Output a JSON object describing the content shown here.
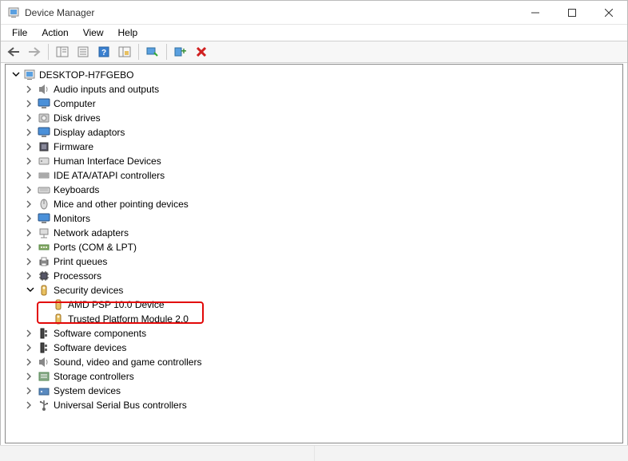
{
  "window": {
    "title": "Device Manager"
  },
  "menu": {
    "file": "File",
    "action": "Action",
    "view": "View",
    "help": "Help"
  },
  "tree": {
    "root": "DESKTOP-H7FGEBO",
    "categories": [
      {
        "label": "Audio inputs and outputs",
        "icon": "speaker",
        "expanded": false
      },
      {
        "label": "Computer",
        "icon": "monitor",
        "expanded": false
      },
      {
        "label": "Disk drives",
        "icon": "disk",
        "expanded": false
      },
      {
        "label": "Display adaptors",
        "icon": "monitor",
        "expanded": false
      },
      {
        "label": "Firmware",
        "icon": "chip",
        "expanded": false
      },
      {
        "label": "Human Interface Devices",
        "icon": "hid",
        "expanded": false
      },
      {
        "label": "IDE ATA/ATAPI controllers",
        "icon": "ide",
        "expanded": false
      },
      {
        "label": "Keyboards",
        "icon": "keyboard",
        "expanded": false
      },
      {
        "label": "Mice and other pointing devices",
        "icon": "mouse",
        "expanded": false
      },
      {
        "label": "Monitors",
        "icon": "monitor",
        "expanded": false
      },
      {
        "label": "Network adapters",
        "icon": "network",
        "expanded": false
      },
      {
        "label": "Ports (COM & LPT)",
        "icon": "port",
        "expanded": false
      },
      {
        "label": "Print queues",
        "icon": "printer",
        "expanded": false
      },
      {
        "label": "Processors",
        "icon": "cpu",
        "expanded": false
      },
      {
        "label": "Security devices",
        "icon": "security",
        "expanded": true,
        "children": [
          {
            "label": "AMD PSP 10.0 Device",
            "icon": "security"
          },
          {
            "label": "Trusted Platform Module 2.0",
            "icon": "security",
            "highlighted": true
          }
        ]
      },
      {
        "label": "Software components",
        "icon": "component",
        "expanded": false
      },
      {
        "label": "Software devices",
        "icon": "component",
        "expanded": false
      },
      {
        "label": "Sound, video and game controllers",
        "icon": "speaker",
        "expanded": false
      },
      {
        "label": "Storage controllers",
        "icon": "storage",
        "expanded": false
      },
      {
        "label": "System devices",
        "icon": "system",
        "expanded": false
      },
      {
        "label": "Universal Serial Bus controllers",
        "icon": "usb",
        "expanded": false
      }
    ]
  }
}
